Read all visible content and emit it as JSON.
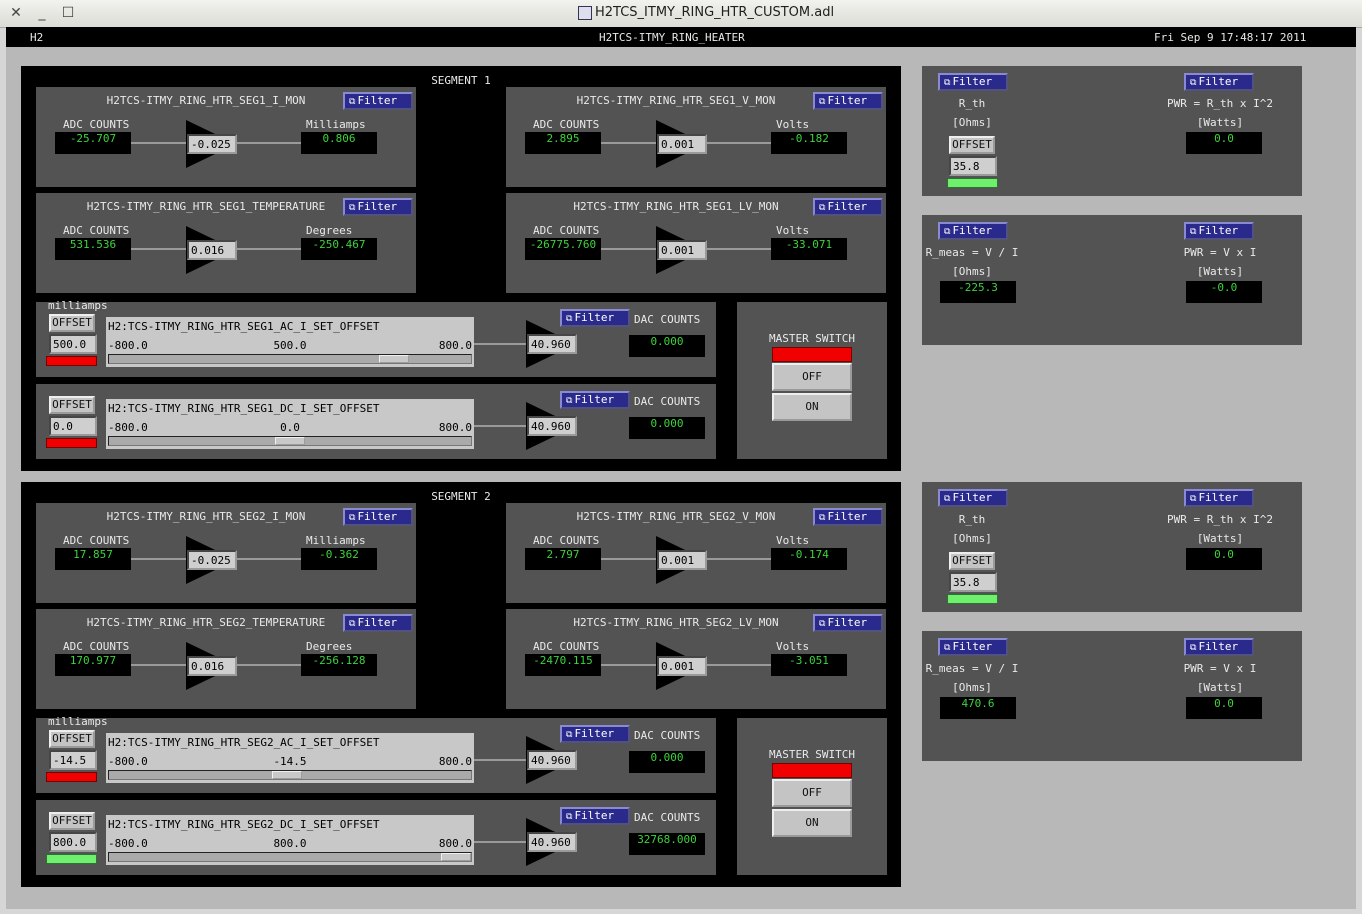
{
  "window": {
    "title": "H2TCS_ITMY_RING_HTR_CUSTOM.adl"
  },
  "header": {
    "left": "H2",
    "center": "H2TCS-ITMY_RING_HEATER",
    "right": "Fri Sep  9 17:48:17 2011"
  },
  "common": {
    "filter": "Filter",
    "adc_counts": "ADC COUNTS",
    "dac_counts": "DAC COUNTS",
    "offset": "OFFSET",
    "milliamps_caption": "milliamps",
    "master_switch": "MASTER SWITCH",
    "off": "OFF",
    "on": "ON",
    "milliamps": "Milliamps",
    "volts": "Volts",
    "degrees": "Degrees"
  },
  "seg1": {
    "title": "SEGMENT 1",
    "i_mon": {
      "name": "H2TCS-ITMY_RING_HTR_SEG1_I_MON",
      "adc": "-25.707",
      "gain": "-0.025",
      "out": "0.806"
    },
    "v_mon": {
      "name": "H2TCS-ITMY_RING_HTR_SEG1_V_MON",
      "adc": "2.895",
      "gain": "0.001",
      "out": "-0.182"
    },
    "temp": {
      "name": "H2TCS-ITMY_RING_HTR_SEG1_TEMPERATURE",
      "adc": "531.536",
      "gain": "0.016",
      "out": "-250.467"
    },
    "lv_mon": {
      "name": "H2TCS-ITMY_RING_HTR_SEG1_LV_MON",
      "adc": "-26775.760",
      "gain": "0.001",
      "out": "-33.071"
    },
    "ac": {
      "name": "H2:TCS-ITMY_RING_HTR_SEG1_AC_I_SET_OFFSET",
      "offset_val": "500.0",
      "min": "-800.0",
      "max": "800.0",
      "value": "500.0",
      "gain": "40.960",
      "dac": "0.000",
      "status": "red",
      "pos": 500
    },
    "dc": {
      "name": "H2:TCS-ITMY_RING_HTR_SEG1_DC_I_SET_OFFSET",
      "offset_val": "0.0",
      "min": "-800.0",
      "max": "800.0",
      "value": "0.0",
      "gain": "40.960",
      "dac": "0.000",
      "status": "red",
      "pos": 0
    },
    "rth": {
      "label": "R_th",
      "unit": "[Ohms]",
      "offset_val": "35.8",
      "pwr_label": "PWR = R_th x I^2",
      "pwr_unit": "[Watts]",
      "pwr": "0.0"
    },
    "rmeas": {
      "label": "R_meas = V / I",
      "unit": "[Ohms]",
      "val": "-225.3",
      "pwr_label": "PWR = V x I",
      "pwr_unit": "[Watts]",
      "pwr": "-0.0"
    }
  },
  "seg2": {
    "title": "SEGMENT 2",
    "i_mon": {
      "name": "H2TCS-ITMY_RING_HTR_SEG2_I_MON",
      "adc": "17.857",
      "gain": "-0.025",
      "out": "-0.362"
    },
    "v_mon": {
      "name": "H2TCS-ITMY_RING_HTR_SEG2_V_MON",
      "adc": "2.797",
      "gain": "0.001",
      "out": "-0.174"
    },
    "temp": {
      "name": "H2TCS-ITMY_RING_HTR_SEG2_TEMPERATURE",
      "adc": "170.977",
      "gain": "0.016",
      "out": "-256.128"
    },
    "lv_mon": {
      "name": "H2TCS-ITMY_RING_HTR_SEG2_LV_MON",
      "adc": "-2470.115",
      "gain": "0.001",
      "out": "-3.051"
    },
    "ac": {
      "name": "H2:TCS-ITMY_RING_HTR_SEG2_AC_I_SET_OFFSET",
      "offset_val": "-14.5",
      "min": "-800.0",
      "max": "800.0",
      "value": "-14.5",
      "gain": "40.960",
      "dac": "0.000",
      "status": "red",
      "pos": -14.5
    },
    "dc": {
      "name": "H2:TCS-ITMY_RING_HTR_SEG2_DC_I_SET_OFFSET",
      "offset_val": "800.0",
      "min": "-800.0",
      "max": "800.0",
      "value": "800.0",
      "gain": "40.960",
      "dac": "32768.000",
      "status": "green",
      "pos": 800
    },
    "rth": {
      "label": "R_th",
      "unit": "[Ohms]",
      "offset_val": "35.8",
      "pwr_label": "PWR = R_th x I^2",
      "pwr_unit": "[Watts]",
      "pwr": "0.0"
    },
    "rmeas": {
      "label": "R_meas = V / I",
      "unit": "[Ohms]",
      "val": "470.6",
      "pwr_label": "PWR = V x I",
      "pwr_unit": "[Watts]",
      "pwr": "0.0"
    }
  }
}
